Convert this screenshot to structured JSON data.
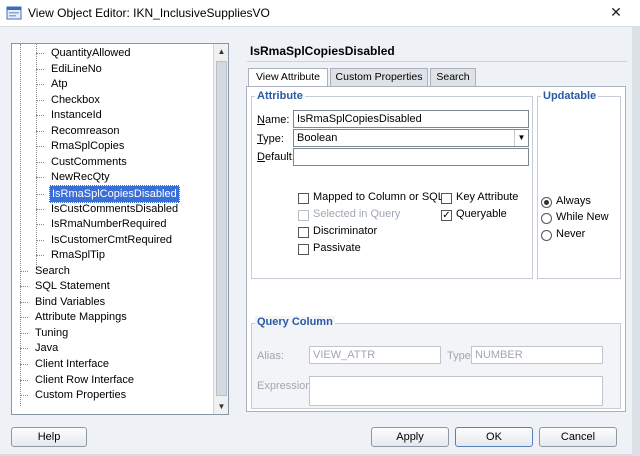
{
  "window": {
    "title": "View Object Editor: IKN_InclusiveSuppliesVO",
    "close_glyph": "✕"
  },
  "tree": {
    "attribute_items": [
      {
        "label": "QuantityAllowed",
        "selected": false
      },
      {
        "label": "EdiLineNo",
        "selected": false
      },
      {
        "label": "Atp",
        "selected": false
      },
      {
        "label": "Checkbox",
        "selected": false
      },
      {
        "label": "InstanceId",
        "selected": false
      },
      {
        "label": "Recomreason",
        "selected": false
      },
      {
        "label": "RmaSplCopies",
        "selected": false
      },
      {
        "label": "CustComments",
        "selected": false
      },
      {
        "label": "NewRecQty",
        "selected": false
      },
      {
        "label": "IsRmaSplCopiesDisabled",
        "selected": true
      },
      {
        "label": "IsCustCommentsDisabled",
        "selected": false
      },
      {
        "label": "IsRmaNumberRequired",
        "selected": false
      },
      {
        "label": "IsCustomerCmtRequired",
        "selected": false
      },
      {
        "label": "RmaSplTip",
        "selected": false
      }
    ],
    "section_items": [
      "Search",
      "SQL Statement",
      "Bind Variables",
      "Attribute Mappings",
      "Tuning",
      "Java",
      "Client Interface",
      "Client Row Interface",
      "Custom Properties"
    ]
  },
  "attribute_title": "IsRmaSplCopiesDisabled",
  "tabs": [
    {
      "label": "View Attribute",
      "active": true
    },
    {
      "label": "Custom Properties",
      "active": false
    },
    {
      "label": "Search",
      "active": false
    }
  ],
  "attribute_group": {
    "legend": "Attribute",
    "name_label": "Name:",
    "name_value": "IsRmaSplCopiesDisabled",
    "type_label": "Type:",
    "type_value": "Boolean",
    "default_label": "Default:",
    "default_value": ""
  },
  "checkboxes": {
    "mapped": {
      "label": "Mapped to Column or SQL",
      "checked": false,
      "enabled": true
    },
    "selected_in_query": {
      "label": "Selected in Query",
      "checked": false,
      "enabled": false
    },
    "discriminator": {
      "label": "Discriminator",
      "checked": false,
      "enabled": true
    },
    "passivate": {
      "label": "Passivate",
      "checked": false,
      "enabled": true
    },
    "key_attribute": {
      "label": "Key Attribute",
      "checked": false,
      "enabled": true
    },
    "queryable": {
      "label": "Queryable",
      "checked": true,
      "enabled": true
    }
  },
  "updatable": {
    "legend": "Updatable",
    "options": [
      {
        "label": "Always",
        "selected": true
      },
      {
        "label": "While New",
        "selected": false
      },
      {
        "label": "Never",
        "selected": false
      }
    ]
  },
  "query_column": {
    "legend": "Query Column",
    "alias_label": "Alias:",
    "alias_value": "VIEW_ATTR",
    "type_label": "Type:",
    "type_value": "NUMBER",
    "expression_label": "Expression:",
    "expression_value": ""
  },
  "buttons": {
    "help": "Help",
    "apply": "Apply",
    "ok": "OK",
    "cancel": "Cancel"
  },
  "check_glyph": "✓"
}
